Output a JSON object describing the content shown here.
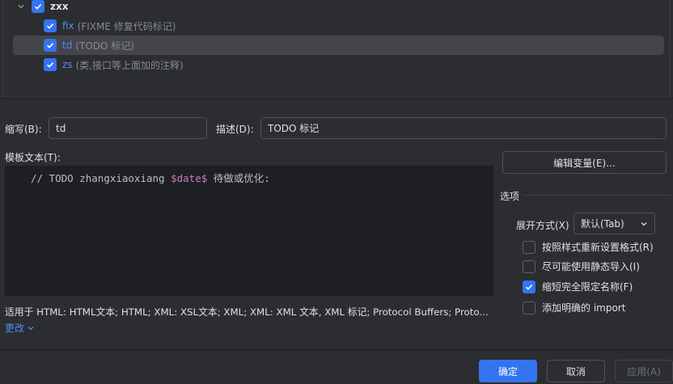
{
  "tree": {
    "group": {
      "label": "zxx",
      "checked": true
    },
    "items": [
      {
        "abbr": "fix",
        "desc": "(FIXME 修复代码标记)",
        "checked": true
      },
      {
        "abbr": "td",
        "desc": "(TODO 标记)",
        "checked": true,
        "selected": true
      },
      {
        "abbr": "zs",
        "desc": "(类,接口等上面加的注释)",
        "checked": true
      }
    ]
  },
  "form": {
    "abbr_label": "缩写(B):",
    "abbr_value": "td",
    "desc_label": "描述(D):",
    "desc_value": "TODO 标记",
    "template_label": "模板文本(T):",
    "template_prefix": "// TODO zhangxiaoxiang ",
    "template_var": "$date$",
    "template_suffix": " 待做或优化:"
  },
  "context": {
    "applies_text": "适用于 HTML: HTML文本; HTML; XML: XSL文本; XML; XML: XML 文本, XML 标记; Protocol Buffers; Proto...",
    "change_link": "更改"
  },
  "options": {
    "edit_vars_button": "编辑变量(E)...",
    "section_title": "选项",
    "expand_label": "展开方式(X)",
    "expand_value": "默认(Tab)",
    "checks": [
      {
        "label": "按照样式重新设置格式(R)",
        "checked": false
      },
      {
        "label": "尽可能使用静态导入(I)",
        "checked": false
      },
      {
        "label": "缩短完全限定名称(F)",
        "checked": true
      },
      {
        "label": "添加明确的 import",
        "checked": false
      }
    ]
  },
  "footer": {
    "ok": "确定",
    "cancel": "取消",
    "apply": "应用(A)"
  },
  "colors": {
    "accent": "#3574f0",
    "link": "#548af7",
    "variable": "#c77dbb",
    "editor_bg": "#1e1f22"
  }
}
